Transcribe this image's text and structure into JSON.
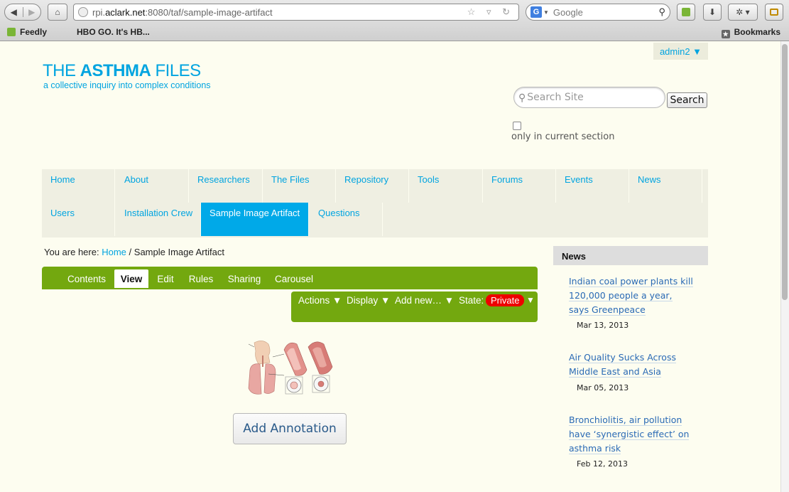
{
  "browser": {
    "url_host_prefix": "rpi.",
    "url_host_main": "aclark.net",
    "url_rest": ":8080/taf/sample-image-artifact",
    "search_engine_icon": "G",
    "search_placeholder": "Google",
    "bookmarks": [
      {
        "label": "Feedly"
      },
      {
        "label": "HBO GO. It's HB..."
      }
    ],
    "bookmarks_menu_label": "Bookmarks"
  },
  "user_menu": {
    "label": "admin2 ▼"
  },
  "site": {
    "title_part1": "THE ",
    "title_part2": "ASTHMA",
    "title_part3": " FILES",
    "tagline": "a collective inquiry into complex conditions"
  },
  "search": {
    "placeholder": "Search Site",
    "button_label": "Search",
    "scope_label": "only in current section"
  },
  "nav": {
    "items": [
      {
        "label": "Home"
      },
      {
        "label": "About"
      },
      {
        "label": "Researchers"
      },
      {
        "label": "The Files"
      },
      {
        "label": "Repository"
      },
      {
        "label": "Tools"
      },
      {
        "label": "Forums"
      },
      {
        "label": "Events"
      },
      {
        "label": "News"
      },
      {
        "label": "Users"
      },
      {
        "label": "Installation Crew"
      },
      {
        "label": "Sample Image Artifact"
      },
      {
        "label": "Questions"
      }
    ]
  },
  "breadcrumb": {
    "prefix": "You are here:",
    "home": "Home",
    "separator": "/",
    "current": "Sample Image Artifact"
  },
  "edit_tabs": [
    {
      "label": "Contents"
    },
    {
      "label": "View"
    },
    {
      "label": "Edit"
    },
    {
      "label": "Rules"
    },
    {
      "label": "Sharing"
    },
    {
      "label": "Carousel"
    }
  ],
  "actions": {
    "actions_label": "Actions ▼",
    "display_label": "Display ▼",
    "add_new_label": "Add new… ▼",
    "state_label": "State:",
    "state_value": "Private",
    "state_arrow": "▼"
  },
  "annotation_button": "Add Annotation",
  "news": {
    "heading": "News",
    "items": [
      {
        "title": "Indian coal power plants kill 120,000 people a year, says Greenpeace",
        "date": "Mar 13, 2013"
      },
      {
        "title": "Air Quality Sucks Across Middle East and Asia",
        "date": "Mar 05, 2013"
      },
      {
        "title": "Bronchiolitis, air pollution have ‘synergistic effect’ on asthma risk",
        "date": "Feb 12, 2013"
      }
    ]
  }
}
